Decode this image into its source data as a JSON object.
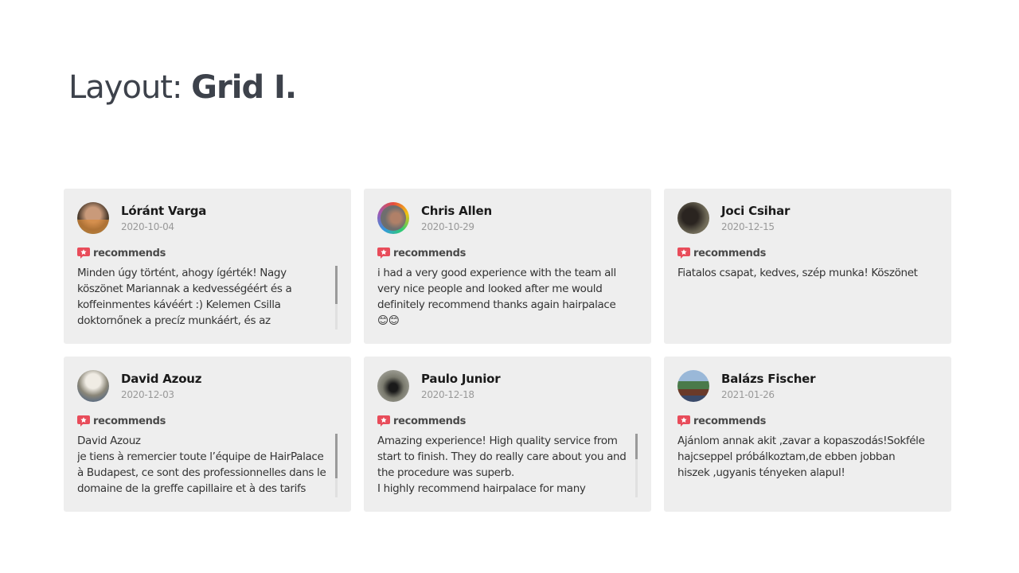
{
  "header": {
    "title_prefix": "Layout: ",
    "title_bold": "Grid I."
  },
  "colors": {
    "card_bg": "#eeeeee",
    "badge_red": "#e84c5a",
    "title": "#3d424b"
  },
  "reviews": [
    {
      "name": "Lóránt Varga",
      "date": "2020-10-04",
      "badge": "recommends",
      "text": "Minden úgy történt, ahogy ígérték! Nagy köszönet Mariannak a kedvességéért és a koffeinmentes kávéért :) Kelemen Csilla doktornőnek a precíz munkáért, és az",
      "scroll_fraction": 0.6
    },
    {
      "name": "Chris Allen",
      "date": "2020-10-29",
      "badge": "recommends",
      "text": "i had a very good experience with the team all very nice people and looked after me would definitely recommend thanks again hairpalace 😊😊",
      "scroll_fraction": null
    },
    {
      "name": "Joci Csihar",
      "date": "2020-12-15",
      "badge": "recommends",
      "text": "Fiatalos csapat, kedves, szép munka! Köszönet",
      "scroll_fraction": null
    },
    {
      "name": "David Azouz",
      "date": "2020-12-03",
      "badge": "recommends",
      "text": "David Azouz\nje tiens à remercier toute l’équipe de HairPalace à Budapest, ce sont des professionnelles dans le domaine de la greffe capillaire et à des tarifs",
      "scroll_fraction": 0.7
    },
    {
      "name": "Paulo Junior",
      "date": "2020-12-18",
      "badge": "recommends",
      "text": "Amazing experience! High quality service from start to finish. They do really care about you and the procedure was superb.\nI highly recommend hairpalace for many",
      "scroll_fraction": 0.4
    },
    {
      "name": "Balázs Fischer",
      "date": "2021-01-26",
      "badge": "recommends",
      "text": "Ajánlom annak akit ,zavar a kopaszodás!Sokféle hajcseppel próbálkoztam,de ebben jobban hiszek ,ugyanis tényeken alapul!",
      "scroll_fraction": null
    }
  ]
}
